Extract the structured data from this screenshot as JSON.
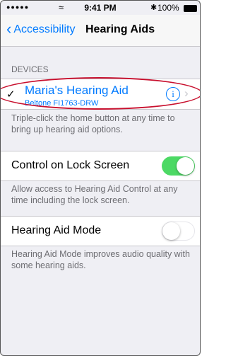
{
  "status_bar": {
    "signal": "●●●●●",
    "wifi_icon": "wifi-icon",
    "time": "9:41 PM",
    "bluetooth_icon": "bluetooth-icon",
    "battery_text": "100%"
  },
  "navbar": {
    "back_label": "Accessibility",
    "title": "Hearing Aids"
  },
  "devices_section": {
    "header": "DEVICES",
    "device": {
      "name": "Maria's Hearing Aid",
      "model": "Beltone FI1763-DRW",
      "selected": true
    },
    "footer": "Triple-click the home button at any time to bring up hearing aid options."
  },
  "control_lock_screen": {
    "label": "Control on Lock Screen",
    "enabled": true,
    "footer": "Allow access to Hearing Aid Control at any time including the lock screen."
  },
  "hearing_aid_mode": {
    "label": "Hearing Aid Mode",
    "enabled": false,
    "footer": "Hearing Aid Mode improves audio quality with some hearing aids."
  },
  "colors": {
    "accent": "#007aff",
    "toggle_on": "#4cd964",
    "annotation": "#c8102e",
    "background": "#efeff4"
  }
}
